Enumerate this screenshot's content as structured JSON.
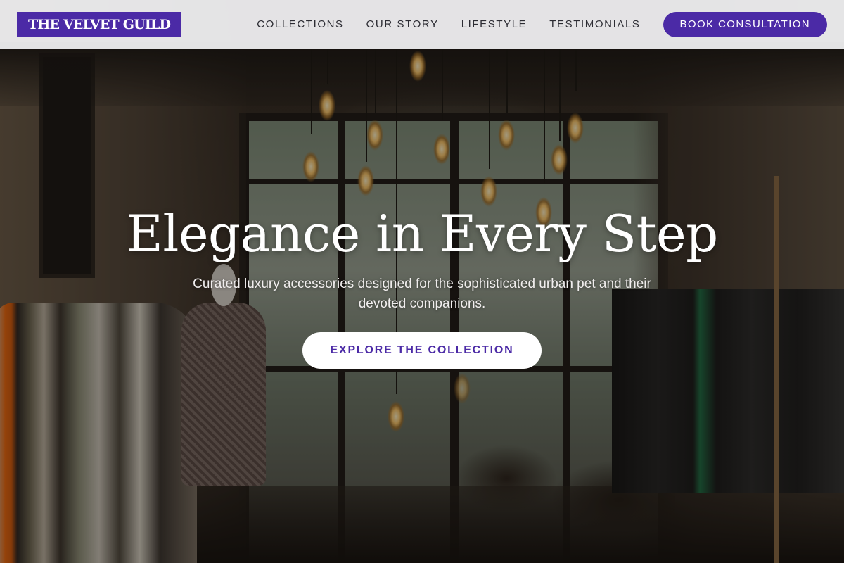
{
  "brand": {
    "name": "THE VELVET GUILD"
  },
  "nav": {
    "links": [
      "COLLECTIONS",
      "OUR STORY",
      "LIFESTYLE",
      "TESTIMONIALS"
    ],
    "cta_label": "BOOK CONSULTATION"
  },
  "hero": {
    "title": "Elegance in Every Step",
    "subtitle": "Curated luxury accessories designed for the sophisticated urban pet and their devoted companions.",
    "button_label": "EXPLORE THE COLLECTION",
    "background_image": "boutique-interior-with-pendant-lamps"
  },
  "colors": {
    "accent": "#4b2aa6",
    "header_bg": "#f0f0f2",
    "button_bg": "#ffffff"
  }
}
